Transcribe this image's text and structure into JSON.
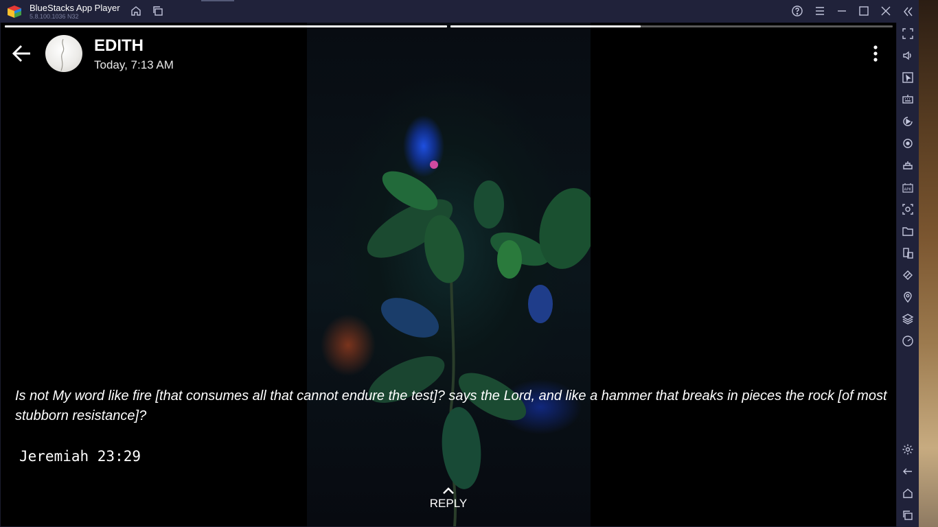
{
  "window": {
    "title": "BlueStacks App Player",
    "version": "5.8.100.1036 N32"
  },
  "titlebar_icons": [
    "home-icon",
    "multi-instance-icon",
    "help-icon",
    "hamburger-menu-icon",
    "minimize-icon",
    "maximize-icon",
    "close-icon",
    "collapse-sidebar-icon"
  ],
  "sidebar_icons": [
    "fullscreen-icon",
    "volume-icon",
    "cursor-icon",
    "keyboard-icon",
    "macro-record-icon",
    "rotate-icon",
    "game-controls-icon",
    "apk-install-icon",
    "screenshot-icon",
    "folder-icon",
    "multi-instance-sync-icon",
    "eco-mode-icon",
    "location-icon",
    "layers-icon",
    "performance-icon",
    "settings-icon",
    "android-back-icon",
    "android-home-icon",
    "android-recents-icon"
  ],
  "status": {
    "contact_name": "EDITH",
    "timestamp": "Today, 7:13 AM",
    "progress": [
      1.0,
      0.43
    ],
    "caption": "Is not My word like fire [that consumes all that cannot endure the test]? says the Lord, and like a hammer that breaks in pieces the rock [of most stubborn resistance]?",
    "reference": "Jeremiah 23:29",
    "reply_label": "REPLY"
  },
  "colors": {
    "chrome": "#20223a",
    "chrome_icon": "#c3c6dc",
    "screen_bg": "#000000",
    "text": "#ffffff"
  }
}
